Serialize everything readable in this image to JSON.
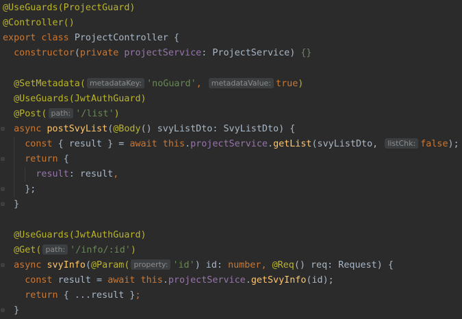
{
  "editor": {
    "lines": [
      {
        "tokens": [
          {
            "t": "@UseGuards(ProjectGuard)",
            "c": "ann"
          }
        ]
      },
      {
        "tokens": [
          {
            "t": "@Controller()",
            "c": "ann"
          }
        ]
      },
      {
        "tokens": [
          {
            "t": "export class ",
            "c": "kw"
          },
          {
            "t": "ProjectController {",
            "c": "txt"
          }
        ]
      },
      {
        "tokens": [
          {
            "t": "  constructor",
            "c": "kw"
          },
          {
            "t": "(",
            "c": "txt"
          },
          {
            "t": "private ",
            "c": "kw"
          },
          {
            "t": "projectService",
            "c": "field"
          },
          {
            "t": ": ProjectService) ",
            "c": "txt"
          },
          {
            "t": "{}",
            "c": "str"
          }
        ]
      },
      {
        "tokens": []
      },
      {
        "tokens": [
          {
            "t": "  @SetMetadata(",
            "c": "ann"
          },
          {
            "hint": "metadataKey:"
          },
          {
            "t": "'noGuard'",
            "c": "str"
          },
          {
            "t": ", ",
            "c": "kw"
          },
          {
            "hint": "metadataValue:"
          },
          {
            "t": "true",
            "c": "kw"
          },
          {
            "t": ")",
            "c": "ann"
          }
        ]
      },
      {
        "tokens": [
          {
            "t": "  @UseGuards(JwtAuthGuard)",
            "c": "ann"
          }
        ]
      },
      {
        "tokens": [
          {
            "t": "  @Post(",
            "c": "ann"
          },
          {
            "hint": "path:"
          },
          {
            "t": "'/list'",
            "c": "str"
          },
          {
            "t": ")",
            "c": "ann"
          }
        ]
      },
      {
        "tokens": [
          {
            "t": "  async ",
            "c": "kw"
          },
          {
            "t": "postSvyList",
            "c": "fn"
          },
          {
            "t": "(",
            "c": "txt"
          },
          {
            "t": "@Body",
            "c": "ann"
          },
          {
            "t": "() svyListDto: SvyListDto) {",
            "c": "txt"
          }
        ]
      },
      {
        "tokens": [
          {
            "t": "    const ",
            "c": "kw"
          },
          {
            "t": "{ result } = ",
            "c": "txt"
          },
          {
            "t": "await this",
            "c": "kw"
          },
          {
            "t": ".",
            "c": "txt"
          },
          {
            "t": "projectService",
            "c": "field"
          },
          {
            "t": ".",
            "c": "txt"
          },
          {
            "t": "getList",
            "c": "fn"
          },
          {
            "t": "(svyListDto, ",
            "c": "txt"
          },
          {
            "hint": "listChk:"
          },
          {
            "t": "false",
            "c": "kw"
          },
          {
            "t": ");",
            "c": "txt"
          }
        ]
      },
      {
        "tokens": [
          {
            "t": "    return ",
            "c": "kw"
          },
          {
            "t": "{",
            "c": "txt"
          }
        ]
      },
      {
        "tokens": [
          {
            "t": "      result",
            "c": "field"
          },
          {
            "t": ": result",
            "c": "txt"
          },
          {
            "t": ",",
            "c": "kw"
          }
        ]
      },
      {
        "tokens": [
          {
            "t": "    };",
            "c": "txt"
          }
        ]
      },
      {
        "tokens": [
          {
            "t": "  }",
            "c": "txt"
          }
        ]
      },
      {
        "tokens": []
      },
      {
        "tokens": [
          {
            "t": "  @UseGuards(JwtAuthGuard)",
            "c": "ann"
          }
        ]
      },
      {
        "tokens": [
          {
            "t": "  @Get(",
            "c": "ann"
          },
          {
            "hint": "path:"
          },
          {
            "t": "'/info/:id'",
            "c": "str"
          },
          {
            "t": ")",
            "c": "ann"
          }
        ]
      },
      {
        "tokens": [
          {
            "t": "  async ",
            "c": "kw"
          },
          {
            "t": "svyInfo",
            "c": "fn"
          },
          {
            "t": "(",
            "c": "txt"
          },
          {
            "t": "@Param(",
            "c": "ann"
          },
          {
            "hint": "property:"
          },
          {
            "t": "'id'",
            "c": "str"
          },
          {
            "t": ") id: ",
            "c": "txt"
          },
          {
            "t": "number",
            "c": "kw"
          },
          {
            "t": ", ",
            "c": "kw"
          },
          {
            "t": "@Req",
            "c": "ann"
          },
          {
            "t": "() req: Request) {",
            "c": "txt"
          }
        ]
      },
      {
        "tokens": [
          {
            "t": "    const ",
            "c": "kw"
          },
          {
            "t": "result = ",
            "c": "txt"
          },
          {
            "t": "await this",
            "c": "kw"
          },
          {
            "t": ".",
            "c": "txt"
          },
          {
            "t": "projectService",
            "c": "field"
          },
          {
            "t": ".",
            "c": "txt"
          },
          {
            "t": "getSvyInfo",
            "c": "fn"
          },
          {
            "t": "(id);",
            "c": "txt"
          }
        ]
      },
      {
        "tokens": [
          {
            "t": "    return ",
            "c": "kw"
          },
          {
            "t": "{ ...result }",
            "c": "txt"
          },
          {
            "t": ";",
            "c": "kw"
          }
        ]
      },
      {
        "tokens": [
          {
            "t": "  }",
            "c": "txt"
          }
        ]
      }
    ],
    "folds": [
      {
        "line": 8,
        "glyph": "⊟"
      },
      {
        "line": 10,
        "glyph": "⊟"
      },
      {
        "line": 12,
        "glyph": "⊟"
      },
      {
        "line": 13,
        "glyph": "⊟"
      },
      {
        "line": 17,
        "glyph": "⊟"
      },
      {
        "line": 20,
        "glyph": "⊟"
      }
    ]
  }
}
